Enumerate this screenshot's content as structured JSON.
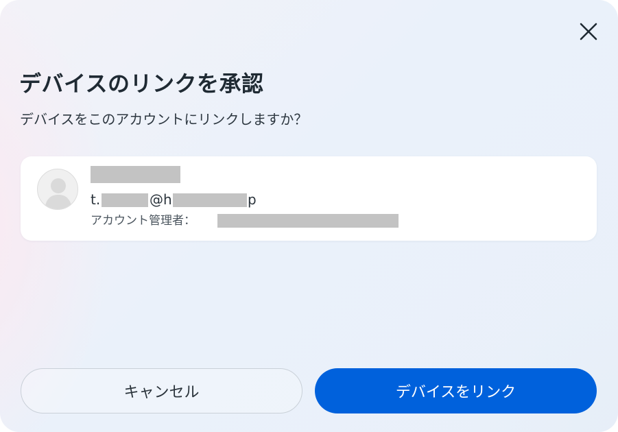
{
  "dialog": {
    "title": "デバイスのリンクを承認",
    "subtitle": "デバイスをこのアカウントにリンクしますか？",
    "close_icon": "close-icon"
  },
  "account": {
    "avatar_icon": "person-avatar-icon",
    "email_prefix": "t.",
    "email_at": "@h",
    "email_suffix": "p",
    "admin_label": "アカウント管理者："
  },
  "actions": {
    "cancel_label": "キャンセル",
    "link_label": "デバイスをリンク"
  },
  "colors": {
    "primary": "#0061dc",
    "title_text": "#1f2a33",
    "redaction": "#c3c3c3"
  }
}
